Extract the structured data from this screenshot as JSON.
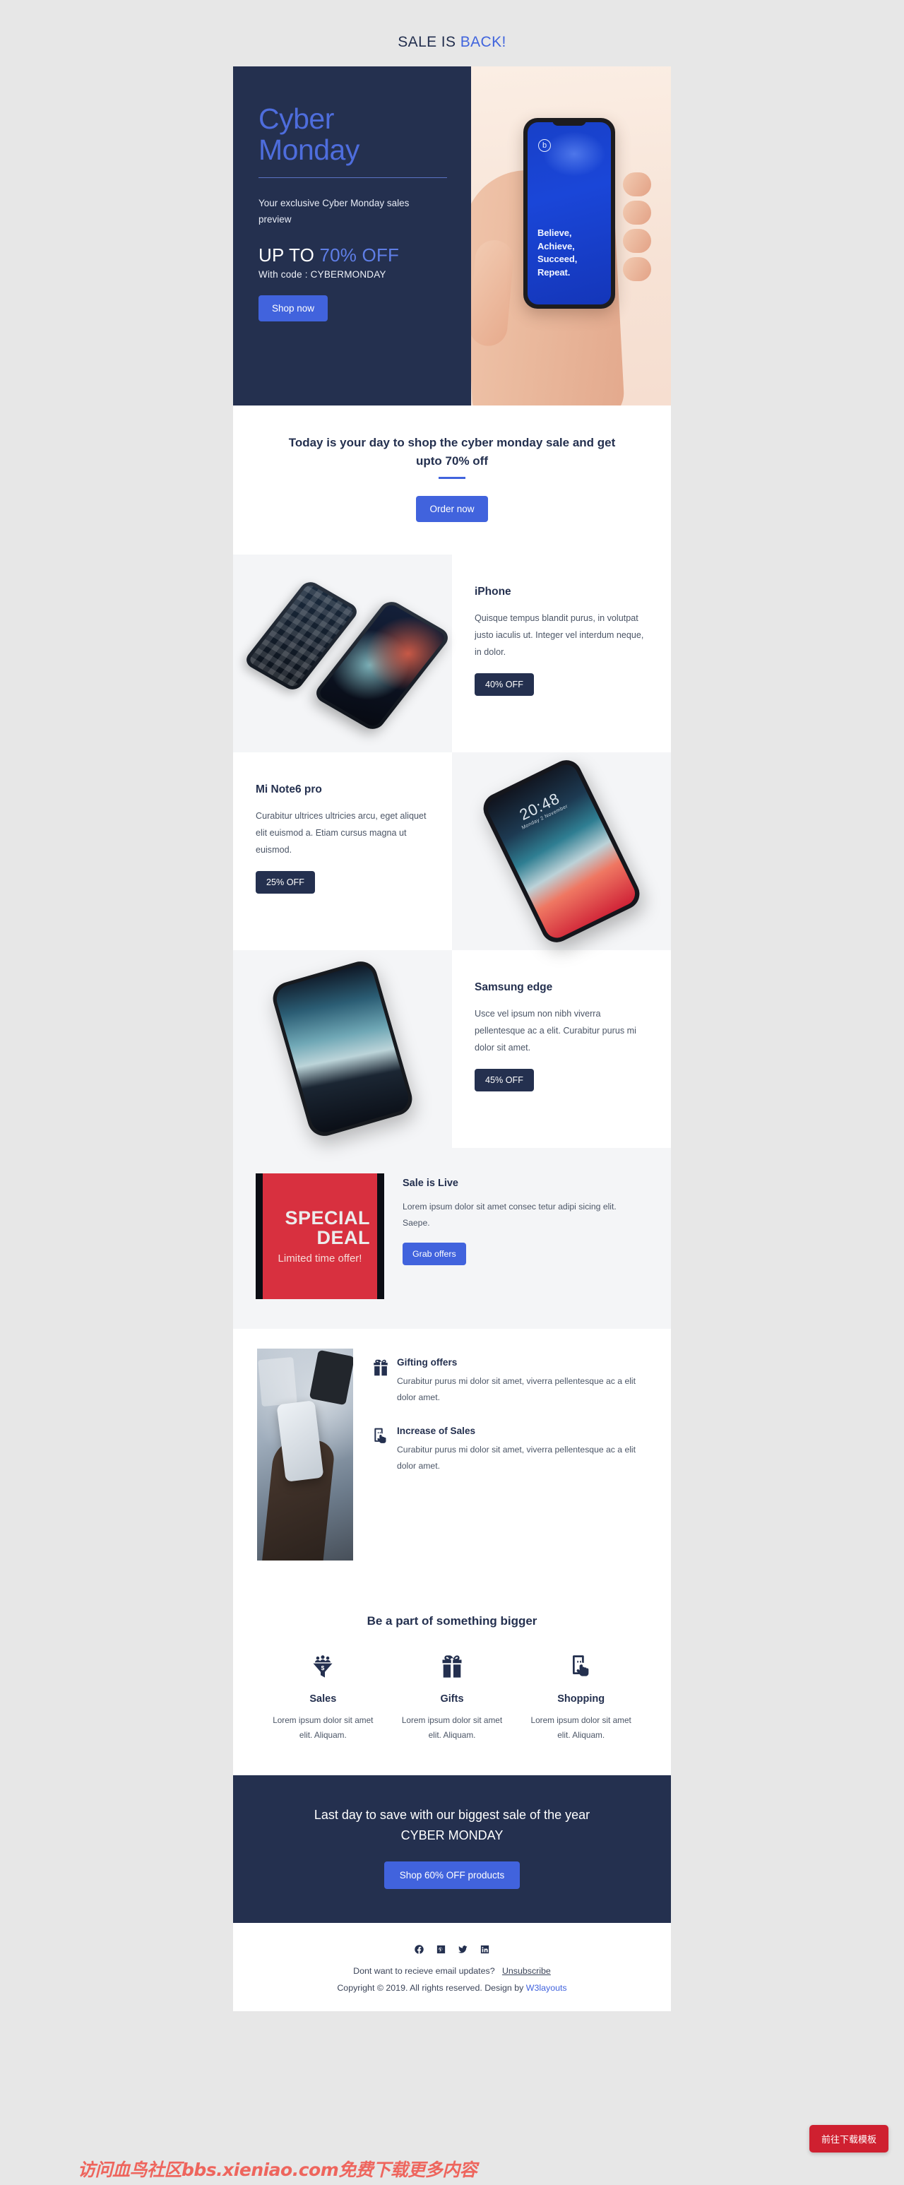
{
  "preheader": {
    "text": "SALE IS ",
    "accent": "BACK!"
  },
  "hero": {
    "title_line1": "Cyber",
    "title_line2": "Monday",
    "subtitle": "Your exclusive Cyber Monday sales preview",
    "offer_prefix": "UP TO ",
    "offer_percent": "70% OFF",
    "code_text": "With code : CYBERMONDAY",
    "cta_label": "Shop now",
    "phone_logo": "b",
    "phone_quote_lines": [
      "Believe,",
      "Achieve,",
      "Succeed,",
      "Repeat."
    ]
  },
  "intro": {
    "heading": "Today is your day to shop the cyber monday sale and get upto 70% off",
    "cta_label": "Order now"
  },
  "products": [
    {
      "name": "iPhone",
      "desc": "Quisque tempus blandit purus, in volutpat justo iaculis ut. Integer vel interdum neque, in dolor.",
      "badge": "40% OFF",
      "image_alt": "two-phones-angled"
    },
    {
      "name": "Mi Note6 pro",
      "desc": "Curabitur ultrices ultricies arcu, eget aliquet elit euismod a. Etiam cursus magna ut euismod.",
      "badge": "25% OFF",
      "image_alt": "tilted-phone-lockscreen",
      "lockscreen_time": "20:48",
      "lockscreen_date": "Monday 2 November"
    },
    {
      "name": "Samsung edge",
      "desc": "Usce vel ipsum non nibh viverra pellentesque ac a elit. Curabitur purus mi dolor sit amet.",
      "badge": "45% OFF",
      "image_alt": "samsung-edge-phone"
    }
  ],
  "deal": {
    "card_line1": "SPECIAL",
    "card_line2": "DEAL",
    "card_line3": "Limited time offer!",
    "heading": "Sale is Live",
    "desc": "Lorem ipsum dolor sit amet consec tetur adipi sicing elit. Saepe.",
    "cta_label": "Grab offers"
  },
  "features": [
    {
      "icon": "gift-icon",
      "title": "Gifting offers",
      "desc": "Curabitur purus mi dolor sit amet, viverra pellentesque ac a elit dolor amet."
    },
    {
      "icon": "mobile-tap-icon",
      "title": "Increase of Sales",
      "desc": "Curabitur purus mi dolor sit amet, viverra pellentesque ac a elit dolor amet."
    }
  ],
  "bigger": {
    "heading": "Be a part of something bigger",
    "columns": [
      {
        "icon": "sales-funnel-icon",
        "title": "Sales",
        "desc": "Lorem ipsum dolor sit amet elit. Aliquam."
      },
      {
        "icon": "gift-icon",
        "title": "Gifts",
        "desc": "Lorem ipsum dolor sit amet elit. Aliquam."
      },
      {
        "icon": "mobile-tap-icon",
        "title": "Shopping",
        "desc": "Lorem ipsum dolor sit amet elit. Aliquam."
      }
    ]
  },
  "last_cta": {
    "line1": "Last day to save with our biggest sale of the year",
    "line2": "CYBER MONDAY",
    "button": "Shop 60% OFF products"
  },
  "footer": {
    "socials": [
      "facebook-icon",
      "pinterest-icon",
      "twitter-icon",
      "linkedin-icon"
    ],
    "unsub_text": "Dont want to recieve email updates?",
    "unsub_link": "Unsubscribe",
    "copyright": "Copyright © 2019. All rights reserved. Design by ",
    "brand": "W3layouts"
  },
  "overlays": {
    "watermark": "访问血鸟社区bbs.xieniao.com免费下载更多内容",
    "float_button": "前往下载模板"
  },
  "colors": {
    "navy": "#24304f",
    "blue": "#4163dd",
    "red": "#d8303f",
    "page_bg": "#e7e7e7"
  }
}
